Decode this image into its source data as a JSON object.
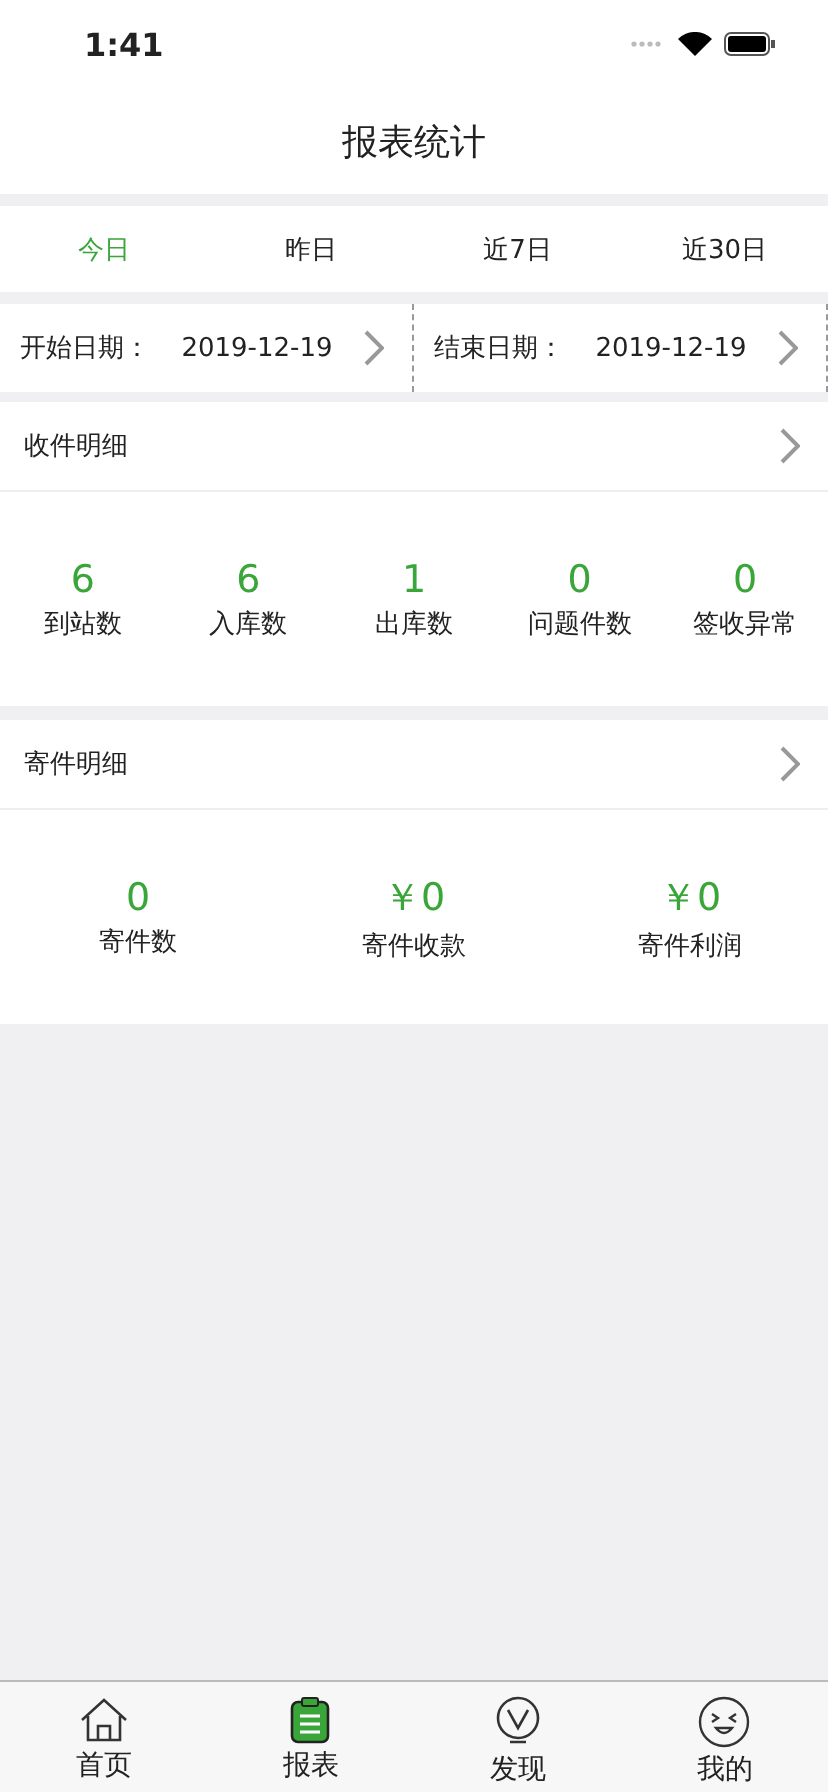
{
  "status_bar": {
    "time": "1:41"
  },
  "title": "报表统计",
  "periods": [
    {
      "label": "今日",
      "selected": true
    },
    {
      "label": "昨日",
      "selected": false
    },
    {
      "label": "近7日",
      "selected": false
    },
    {
      "label": "近30日",
      "selected": false
    }
  ],
  "date_range": [
    {
      "label": "开始日期：",
      "value": "2019-12-19"
    },
    {
      "label": "结束日期：",
      "value": "2019-12-19"
    }
  ],
  "sections": [
    {
      "title": "收件明细",
      "stats": [
        {
          "value": "6",
          "label": "到站数"
        },
        {
          "value": "6",
          "label": "入库数"
        },
        {
          "value": "1",
          "label": "出库数"
        },
        {
          "value": "0",
          "label": "问题件数"
        },
        {
          "value": "0",
          "label": "签收异常"
        }
      ]
    },
    {
      "title": "寄件明细",
      "stats": [
        {
          "value": "0",
          "label": "寄件数"
        },
        {
          "value": "￥0",
          "label": "寄件收款"
        },
        {
          "value": "￥0",
          "label": "寄件利润"
        }
      ]
    }
  ],
  "tab_bar": [
    {
      "kind": "home",
      "label": "首页",
      "selected": false
    },
    {
      "kind": "report",
      "label": "报表",
      "selected": true
    },
    {
      "kind": "discover",
      "label": "发现",
      "selected": false
    },
    {
      "kind": "mine",
      "label": "我的",
      "selected": false
    }
  ]
}
